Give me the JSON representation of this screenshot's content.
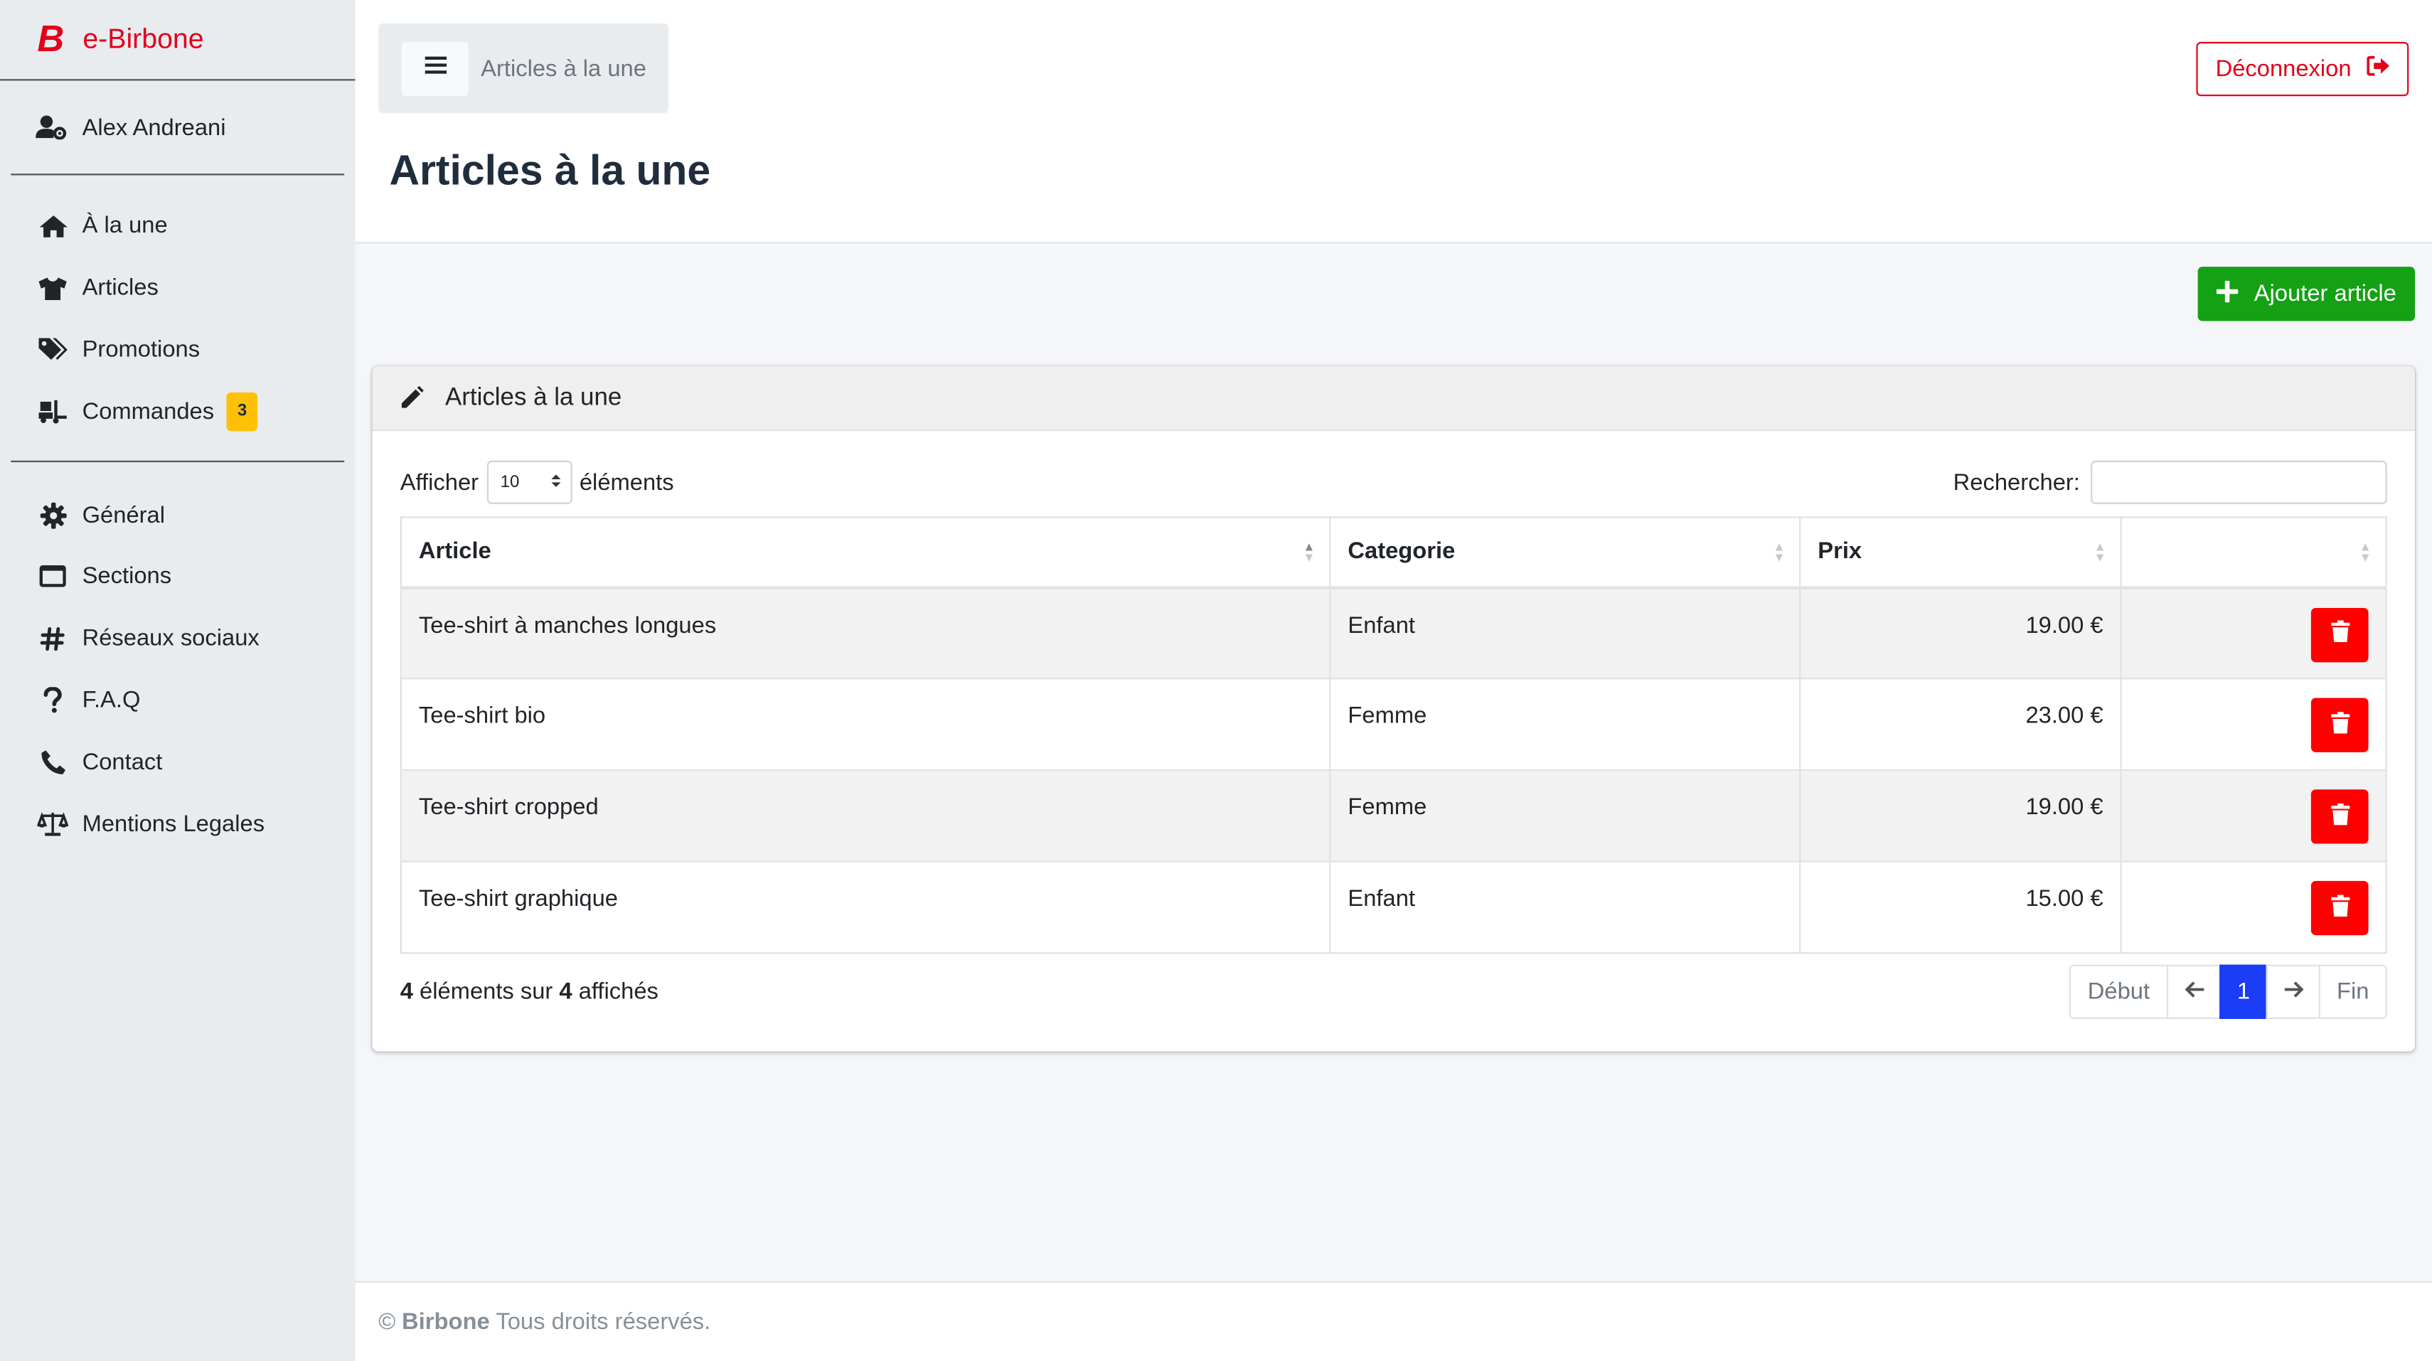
{
  "brand": {
    "logo_letter": "B",
    "name": "e-Birbone",
    "color": "#e3001b"
  },
  "user": {
    "name": "Alex Andreani",
    "icon": "user-cog-icon"
  },
  "sidebar": {
    "group1": [
      {
        "label": "À la une",
        "icon": "home-icon"
      },
      {
        "label": "Articles",
        "icon": "tshirt-icon"
      },
      {
        "label": "Promotions",
        "icon": "tags-icon"
      },
      {
        "label": "Commandes",
        "icon": "truck-loading-icon",
        "badge": "3"
      }
    ],
    "group2": [
      {
        "label": "Général",
        "icon": "gear-icon"
      },
      {
        "label": "Sections",
        "icon": "window-icon"
      },
      {
        "label": "Réseaux sociaux",
        "icon": "hashtag-icon"
      },
      {
        "label": "F.A.Q",
        "icon": "question-icon"
      },
      {
        "label": "Contact",
        "icon": "phone-icon"
      },
      {
        "label": "Mentions Legales",
        "icon": "balance-scale-icon"
      }
    ]
  },
  "topbar": {
    "breadcrumb": "Articles à la une",
    "logout_label": "Déconnexion",
    "page_title": "Articles à la une"
  },
  "toolbar": {
    "add_label": "Ajouter article",
    "add_color": "#14a114"
  },
  "card": {
    "title": "Articles à la une",
    "length": {
      "prefix": "Afficher",
      "value": "10",
      "suffix": "éléments"
    },
    "search": {
      "label": "Rechercher:",
      "value": ""
    },
    "table": {
      "columns": [
        "Article",
        "Categorie",
        "Prix",
        ""
      ],
      "rows": [
        {
          "article": "Tee-shirt à manches longues",
          "categorie": "Enfant",
          "prix": "19.00 €"
        },
        {
          "article": "Tee-shirt bio",
          "categorie": "Femme",
          "prix": "23.00 €"
        },
        {
          "article": "Tee-shirt cropped",
          "categorie": "Femme",
          "prix": "19.00 €"
        },
        {
          "article": "Tee-shirt graphique",
          "categorie": "Enfant",
          "prix": "15.00 €"
        }
      ]
    },
    "info": {
      "shown": "4",
      "middle": "éléments sur",
      "total": "4",
      "suffix": "affichés"
    },
    "pagination": {
      "first": "Début",
      "current": "1",
      "last": "Fin"
    }
  },
  "footer": {
    "copyright": "©",
    "company": "Birbone",
    "rights": "Tous droits réservés."
  }
}
